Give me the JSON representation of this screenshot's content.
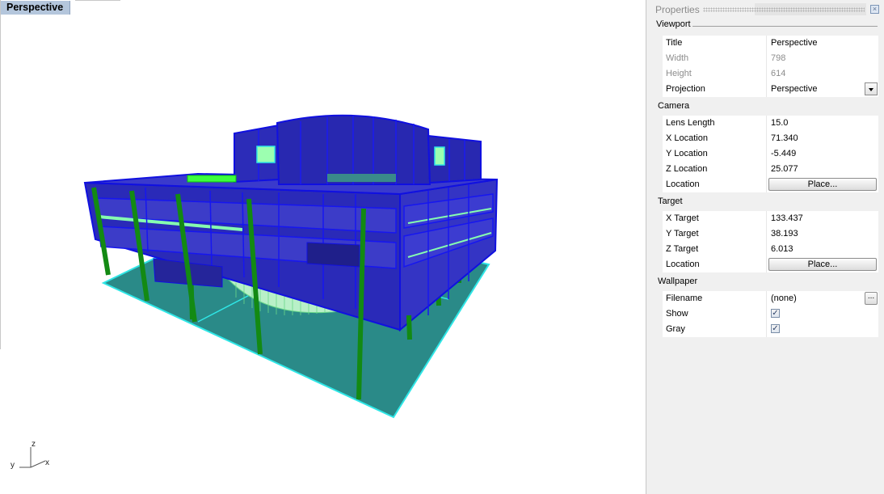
{
  "viewport": {
    "title": "Perspective",
    "axes": {
      "z": "z",
      "y": "y",
      "x": "x"
    }
  },
  "panel": {
    "title": "Properties",
    "sections": {
      "viewport": {
        "label": "Viewport",
        "title": {
          "label": "Title",
          "value": "Perspective"
        },
        "width": {
          "label": "Width",
          "value": "798"
        },
        "height": {
          "label": "Height",
          "value": "614"
        },
        "projection": {
          "label": "Projection",
          "value": "Perspective"
        }
      },
      "camera": {
        "label": "Camera",
        "lens_length": {
          "label": "Lens Length",
          "value": "15.0"
        },
        "x_location": {
          "label": "X Location",
          "value": "71.340"
        },
        "y_location": {
          "label": "Y Location",
          "value": "-5.449"
        },
        "z_location": {
          "label": "Z Location",
          "value": "25.077"
        },
        "location": {
          "label": "Location",
          "button": "Place..."
        }
      },
      "target": {
        "label": "Target",
        "x_target": {
          "label": "X Target",
          "value": "133.437"
        },
        "y_target": {
          "label": "Y Target",
          "value": "38.193"
        },
        "z_target": {
          "label": "Z Target",
          "value": "6.013"
        },
        "location": {
          "label": "Location",
          "button": "Place..."
        }
      },
      "wallpaper": {
        "label": "Wallpaper",
        "filename": {
          "label": "Filename",
          "value": "(none)",
          "browse": "..."
        },
        "show": {
          "label": "Show",
          "checked": true
        },
        "gray": {
          "label": "Gray",
          "checked": true
        }
      }
    }
  },
  "colors": {
    "ground": "#2a8a88",
    "ground_edge": "#2fe6e6",
    "building": "#2a2ab8",
    "building_edge": "#1010e0",
    "columns": "#138a13",
    "highlight": "#7cff7c",
    "titlebar": "#b4c6dc"
  }
}
